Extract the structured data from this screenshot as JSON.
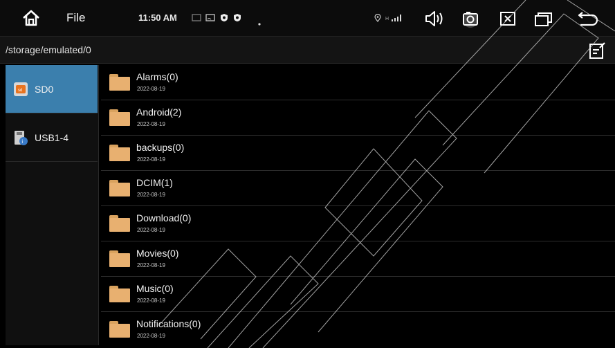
{
  "statusbar": {
    "app_title": "File",
    "time": "11:50 AM",
    "icons": [
      "home-icon",
      "cast-icon",
      "screen-icon",
      "shield-icon",
      "shield-icon",
      "dot-icon",
      "location-icon",
      "signal-icon",
      "volume-icon",
      "screenshot-icon",
      "close-window-icon",
      "multi-window-icon",
      "back-icon"
    ]
  },
  "pathbar": {
    "path": "/storage/emulated/0",
    "edit_icon": "edit-icon"
  },
  "sidebar": {
    "items": [
      {
        "label": "SD0",
        "icon": "sd-card-icon",
        "active": true
      },
      {
        "label": "USB1-4",
        "icon": "usb-icon",
        "active": false
      }
    ]
  },
  "files": [
    {
      "name": "Alarms(0)",
      "date": "2022-08-19"
    },
    {
      "name": "Android(2)",
      "date": "2022-08-19"
    },
    {
      "name": "backups(0)",
      "date": "2022-08-19"
    },
    {
      "name": "DCIM(1)",
      "date": "2022-08-19"
    },
    {
      "name": "Download(0)",
      "date": "2022-08-19"
    },
    {
      "name": "Movies(0)",
      "date": "2022-08-19"
    },
    {
      "name": "Music(0)",
      "date": "2022-08-19"
    },
    {
      "name": "Notifications(0)",
      "date": "2022-08-19"
    }
  ],
  "colors": {
    "active_tab": "#3b7fad",
    "folder": "#e8b070",
    "background": "#000000"
  }
}
